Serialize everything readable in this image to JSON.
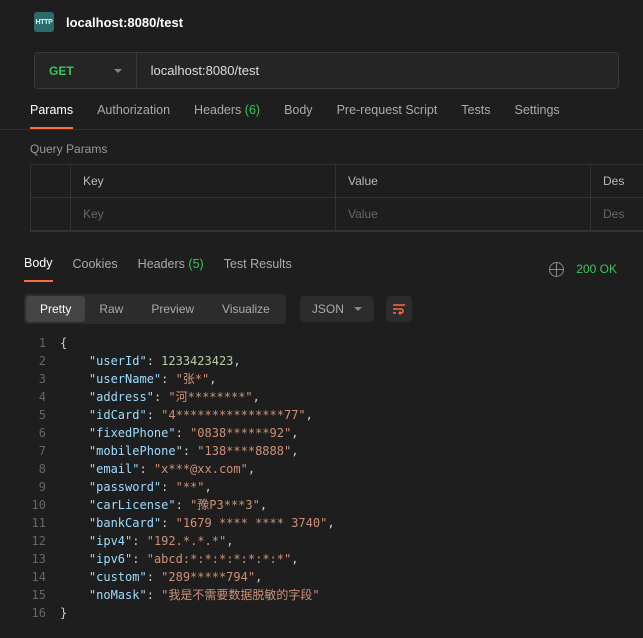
{
  "header": {
    "http_badge": "HTTP",
    "tab_title": "localhost:8080/test"
  },
  "request": {
    "method": "GET",
    "url": "localhost:8080/test"
  },
  "req_tabs": {
    "params": "Params",
    "authorization": "Authorization",
    "headers": "Headers",
    "headers_count": "(6)",
    "body": "Body",
    "prerequest": "Pre-request Script",
    "tests": "Tests",
    "settings": "Settings"
  },
  "query_params": {
    "title": "Query Params",
    "key_header": "Key",
    "value_header": "Value",
    "desc_header": "Des",
    "key_placeholder": "Key",
    "value_placeholder": "Value",
    "desc_placeholder": "Des"
  },
  "resp_tabs": {
    "body": "Body",
    "cookies": "Cookies",
    "headers": "Headers",
    "headers_count": "(5)",
    "test_results": "Test Results"
  },
  "status": {
    "ok": "200 OK"
  },
  "view": {
    "pretty": "Pretty",
    "raw": "Raw",
    "preview": "Preview",
    "visualize": "Visualize",
    "format": "JSON"
  },
  "response_body": {
    "userId": 1233423423,
    "userName": "张*",
    "address": "河********",
    "idCard": "4***************77",
    "fixedPhone": "0838******92",
    "mobilePhone": "138****8888",
    "email": "x***@xx.com",
    "password": "**",
    "carLicense": "豫P3***3",
    "bankCard": "1679 **** **** 3740",
    "ipv4": "192.*.*.*",
    "ipv6": "abcd:*:*:*:*:*:*:*",
    "custom": "289*****794",
    "noMask": "我是不需要数据脱敏的字段"
  },
  "response_order": [
    "userId",
    "userName",
    "address",
    "idCard",
    "fixedPhone",
    "mobilePhone",
    "email",
    "password",
    "carLicense",
    "bankCard",
    "ipv4",
    "ipv6",
    "custom",
    "noMask"
  ]
}
